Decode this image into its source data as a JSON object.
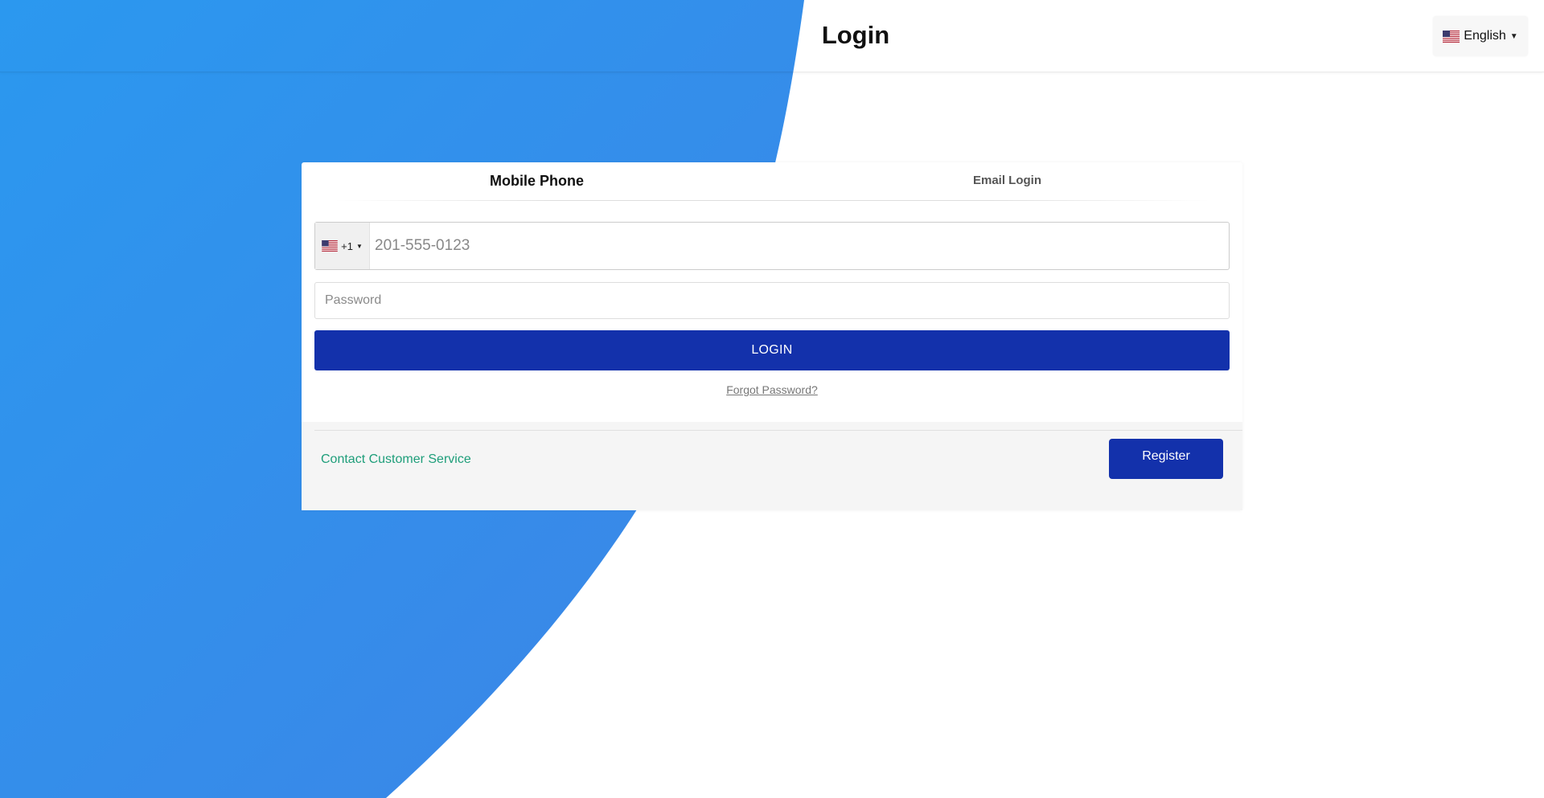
{
  "header": {
    "title": "Login",
    "language": {
      "label": "English",
      "flag_icon": "us-flag-icon"
    }
  },
  "tabs": [
    {
      "label": "Mobile Phone",
      "active": true
    },
    {
      "label": "Email Login",
      "active": false
    }
  ],
  "phone": {
    "country_code": "+1",
    "country_flag_icon": "us-flag-icon",
    "placeholder": "201-555-0123",
    "value": ""
  },
  "password": {
    "placeholder": "Password",
    "value": ""
  },
  "login_button": {
    "label": "LOGIN"
  },
  "forgot_password": {
    "label": "Forgot Password?"
  },
  "footer": {
    "contact_label": "Contact Customer Service",
    "register_label": "Register"
  },
  "colors": {
    "primary_button": "#1331ab",
    "background_blue": "#2f8ff0",
    "contact_link": "#1e9e7a"
  }
}
